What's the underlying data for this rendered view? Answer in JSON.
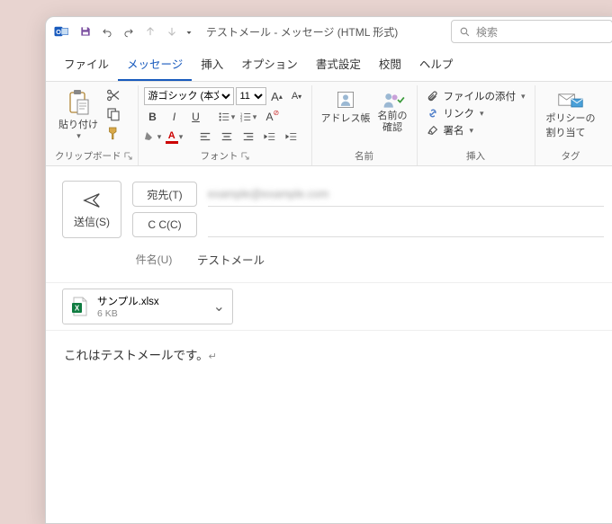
{
  "title": "テストメール  -  メッセージ (HTML 形式)",
  "search_placeholder": "検索",
  "menus": {
    "file": "ファイル",
    "message": "メッセージ",
    "insert": "挿入",
    "options": "オプション",
    "format": "書式設定",
    "review": "校閲",
    "help": "ヘルプ"
  },
  "ribbon": {
    "clipboard": {
      "paste": "貼り付け",
      "label": "クリップボード"
    },
    "font": {
      "name": "游ゴシック (本文のフ",
      "size": "11",
      "label": "フォント"
    },
    "names": {
      "address_book": "アドレス帳",
      "check_names_l1": "名前の",
      "check_names_l2": "確認",
      "label": "名前"
    },
    "include": {
      "attach_file": "ファイルの添付",
      "link": "リンク",
      "signature": "署名",
      "label": "挿入"
    },
    "tags": {
      "policy_l1": "ポリシーの",
      "policy_l2": "割り当て",
      "label": "タグ"
    }
  },
  "compose": {
    "send": "送信(S)",
    "to_btn": "宛先(T)",
    "to_value": "example@example.com",
    "cc_btn": "C C(C)",
    "subject_label": "件名(U)",
    "subject_value": "テストメール"
  },
  "attachment": {
    "name": "サンプル.xlsx",
    "size": "6 KB"
  },
  "body_text": "これはテストメールです。"
}
